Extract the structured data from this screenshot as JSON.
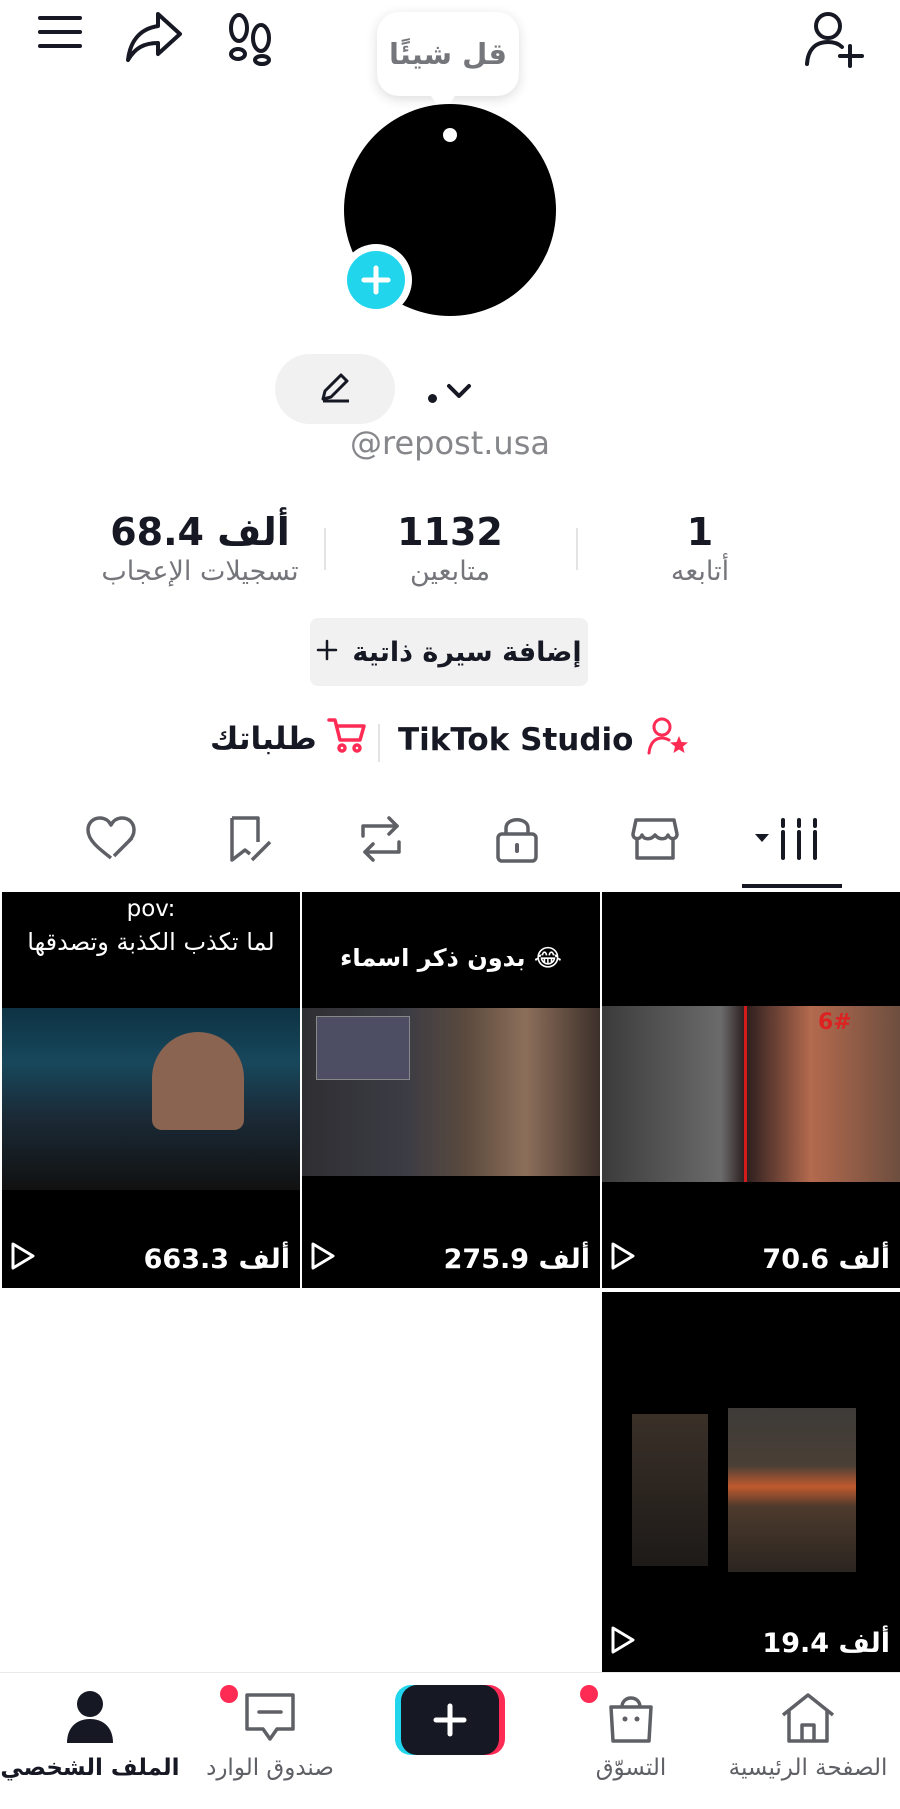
{
  "note": {
    "placeholder": "قل شيئًا"
  },
  "profile": {
    "username": "@repost.usa",
    "edit_icon": "pencil-icon"
  },
  "stats": {
    "likes": {
      "value": "68.4 ألف",
      "label": "تسجيلات الإعجاب"
    },
    "followers": {
      "value": "1132",
      "label": "متابعين"
    },
    "following": {
      "value": "1",
      "label": "أتابعه"
    }
  },
  "bio": {
    "add_label": "إضافة سيرة ذاتية",
    "icon": "plus-icon"
  },
  "links": {
    "studio": "TikTok Studio",
    "orders": "طلباتك"
  },
  "tabs": [
    "videos-grid-icon",
    "shop-icon",
    "lock-icon",
    "repost-icon",
    "favorites-icon",
    "liked-icon"
  ],
  "videos": [
    {
      "views": "70.6 ألف",
      "overlay": "6#"
    },
    {
      "views": "275.9 ألف",
      "caption": "بدون ذكر اسماء 😂"
    },
    {
      "views": "663.3 ألف",
      "caption_top": "pov:",
      "caption": "لما تكذب الكذبة وتصدقها"
    },
    {
      "views": "19.4 ألف"
    }
  ],
  "nav": {
    "home": "الصفحة الرئيسية",
    "shop": "التسوّق",
    "inbox": "صندوق الوارد",
    "profile": "الملف الشخصي"
  },
  "colors": {
    "accent": "#fe2c55",
    "cyan": "#20d5ec",
    "text": "#161823",
    "secondary": "#75767c"
  }
}
